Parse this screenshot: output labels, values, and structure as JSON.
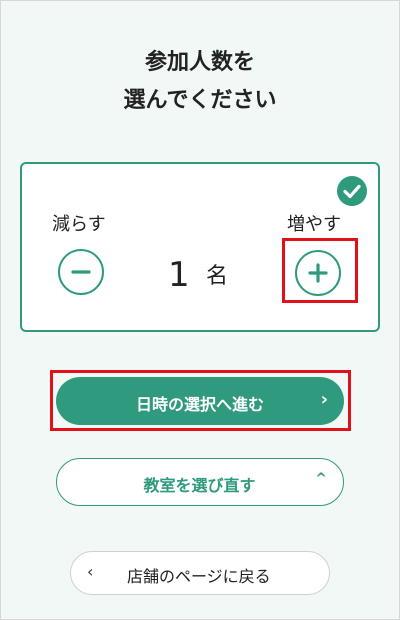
{
  "header": {
    "title_line1": "参加人数を",
    "title_line2": "選んでください"
  },
  "counter": {
    "decrease_label": "減らす",
    "increase_label": "増やす",
    "count": "1",
    "unit": "名",
    "icons": {
      "check": "check-icon",
      "minus": "minus-icon",
      "plus": "plus-icon"
    }
  },
  "actions": {
    "next_label": "日時の選択へ進む",
    "next_chevron": "›",
    "reselect_label": "教室を選び直す",
    "reselect_chevron": "^",
    "back_label": "店舗のページに戻る",
    "back_chevron": "‹"
  },
  "colors": {
    "accent": "#2f9a7e",
    "background": "#f1f8f6",
    "highlight": "#e0111b"
  }
}
